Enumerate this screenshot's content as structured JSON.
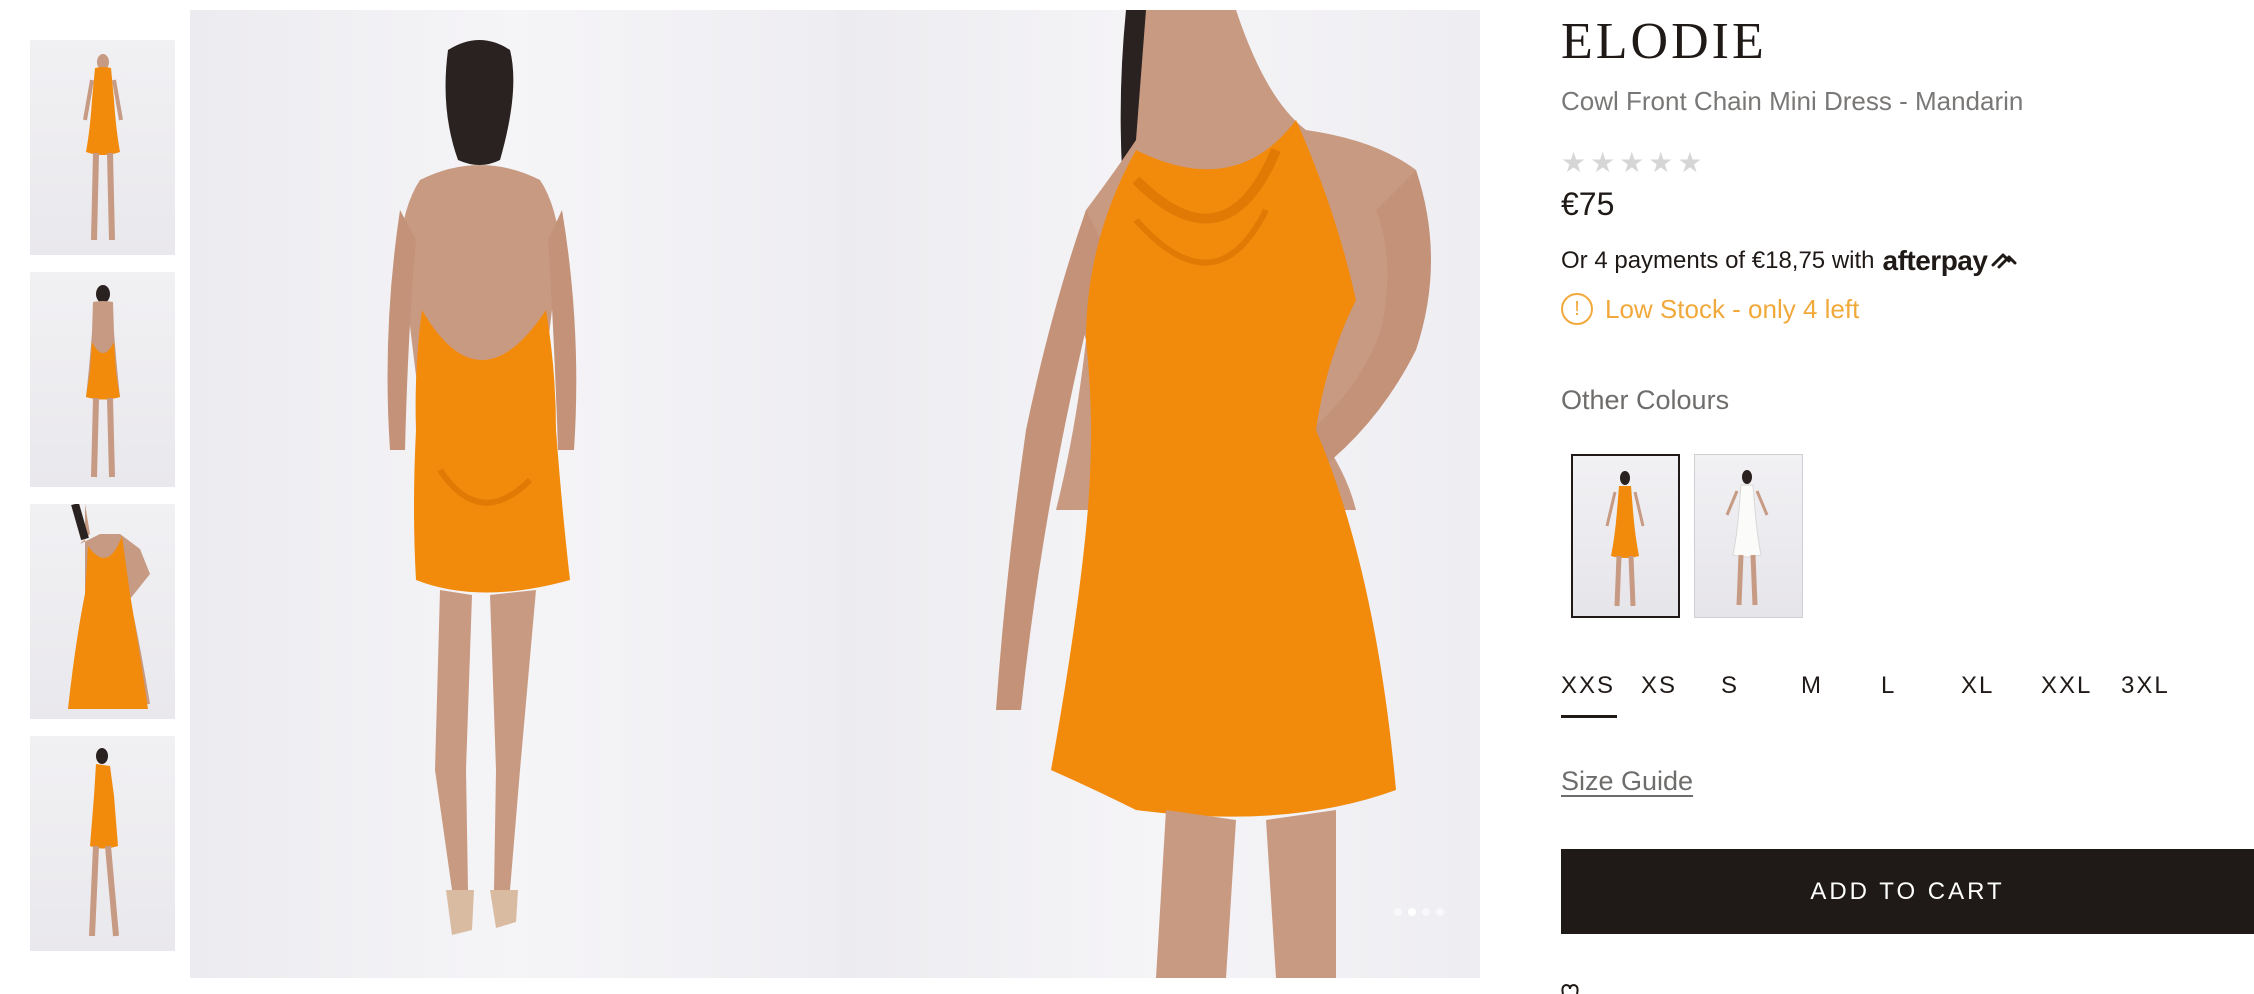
{
  "product": {
    "brand": "ELODIE",
    "name": "Cowl Front Chain Mini Dress - Mandarin",
    "rating_stars": "★★★★★",
    "rating_value": 0,
    "price": "€75",
    "afterpay_text": "Or 4 payments of €18,75 with",
    "afterpay_brand": "afterpay",
    "stock_message": "Low Stock - only 4 left",
    "stock_icon": "!"
  },
  "colours": {
    "label": "Other Colours",
    "options": [
      {
        "name": "Mandarin",
        "color": "#f28a0c",
        "selected": true
      },
      {
        "name": "White",
        "color": "#f4f4f2",
        "selected": false
      }
    ]
  },
  "sizes": {
    "options": [
      "XXS",
      "XS",
      "S",
      "M",
      "L",
      "XL",
      "XXL",
      "3XL"
    ],
    "selected": "XXS"
  },
  "size_guide_label": "Size Guide",
  "add_to_cart_label": "ADD TO CART",
  "gallery": {
    "dress_color": "#f28a0c",
    "background_color": "#efeef2",
    "thumbnail_count": 4,
    "carousel_dots": 4,
    "active_dot": 1
  },
  "colors": {
    "text": "#1f1a17",
    "muted": "#7a7876",
    "warning": "#f2a93b",
    "button_bg": "#1f1a17",
    "button_text": "#ffffff"
  }
}
